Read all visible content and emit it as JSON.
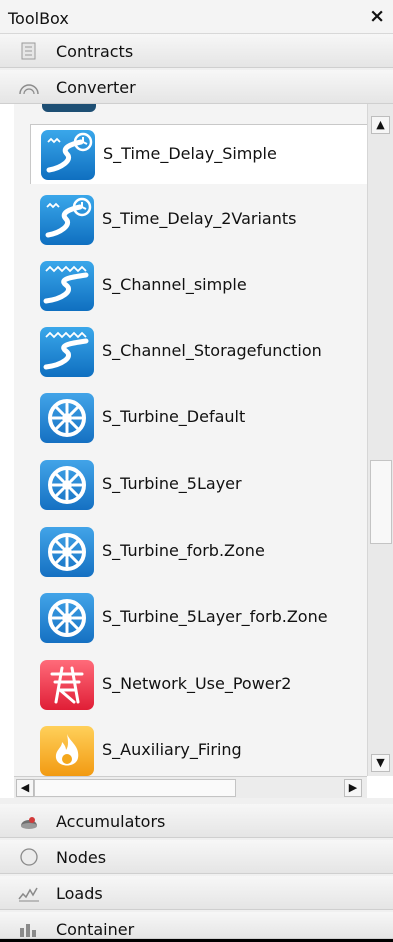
{
  "toolbox": {
    "title": "ToolBox",
    "close_glyph": "×"
  },
  "categories_top": [
    {
      "label": "Contracts",
      "icon": "document-icon"
    },
    {
      "label": "Converter",
      "icon": "converter-icon"
    }
  ],
  "converter_items": [
    {
      "label": "S_Time_Delay_Simple",
      "icon": "time-delay-icon",
      "selected": true
    },
    {
      "label": "S_Time_Delay_2Variants",
      "icon": "time-delay-icon"
    },
    {
      "label": "S_Channel_simple",
      "icon": "channel-icon"
    },
    {
      "label": "S_Channel_Storagefunction",
      "icon": "channel-icon"
    },
    {
      "label": "S_Turbine_Default",
      "icon": "turbine-icon"
    },
    {
      "label": "S_Turbine_5Layer",
      "icon": "turbine-icon"
    },
    {
      "label": "S_Turbine_forb.Zone",
      "icon": "turbine-icon"
    },
    {
      "label": "S_Turbine_5Layer_forb.Zone",
      "icon": "turbine-icon"
    },
    {
      "label": "S_Network_Use_Power2",
      "icon": "power-tower-icon"
    },
    {
      "label": "S_Auxiliary_Firing",
      "icon": "flame-icon"
    }
  ],
  "categories_bottom": [
    {
      "label": "Accumulators",
      "icon": "accumulator-icon"
    },
    {
      "label": "Nodes",
      "icon": "node-icon"
    },
    {
      "label": "Loads",
      "icon": "loads-chart-icon"
    },
    {
      "label": "Container",
      "icon": "container-icon"
    }
  ],
  "colors": {
    "water_icon": "#1f86d6",
    "network_icon": "#f0364a",
    "firing_icon": "#f4a71c"
  }
}
